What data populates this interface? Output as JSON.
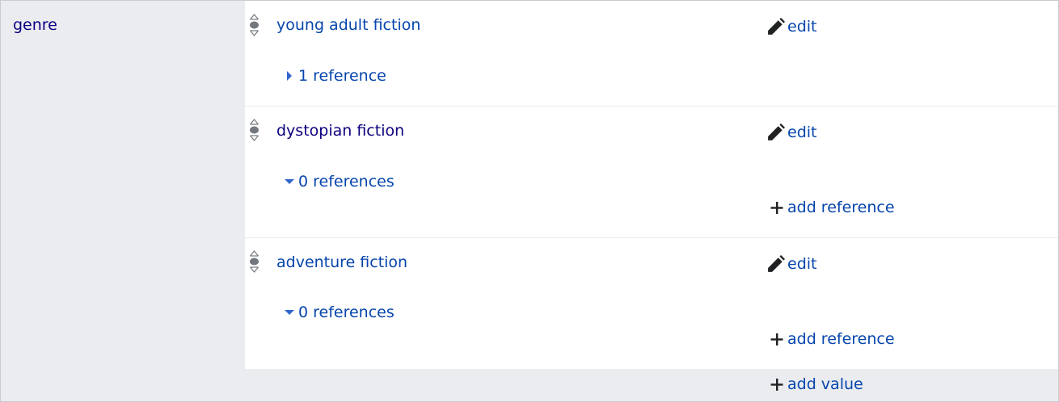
{
  "property": {
    "label": "genre"
  },
  "statements": [
    {
      "value": "young adult fiction",
      "edit_label": "edit",
      "references_label": "1 reference",
      "expanded": false,
      "add_reference_label": ""
    },
    {
      "value": "dystopian fiction",
      "edit_label": "edit",
      "references_label": "0 references",
      "expanded": true,
      "add_reference_label": "add reference"
    },
    {
      "value": "adventure fiction",
      "edit_label": "edit",
      "references_label": "0 references",
      "expanded": true,
      "add_reference_label": "add reference"
    }
  ],
  "add_value_label": "add value",
  "icons": {
    "edit": "pencil-icon",
    "add": "plus-icon",
    "rank": "rank-selector-icon",
    "collapsed": "triangle-right-icon",
    "expanded": "triangle-down-icon"
  },
  "colors": {
    "link": "#0645ad",
    "visited_link": "#0b0080",
    "panel_bg": "#eaecf0",
    "icon": "#202122",
    "toggle_arrow": "#3366cc"
  }
}
